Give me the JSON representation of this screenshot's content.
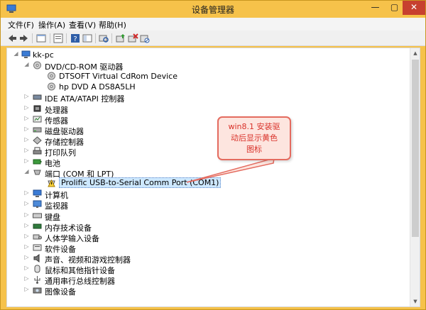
{
  "window": {
    "title": "设备管理器",
    "minimize": "—",
    "maximize": "▢",
    "close": "✕"
  },
  "menu": [
    {
      "label": "文件(F)"
    },
    {
      "label": "操作(A)"
    },
    {
      "label": "查看(V)"
    },
    {
      "label": "帮助(H)"
    }
  ],
  "toolbar": [
    {
      "name": "back-icon"
    },
    {
      "name": "forward-icon"
    },
    {
      "name": "properties-view-icon"
    },
    {
      "name": "show-hide-icon"
    },
    {
      "name": "help-icon"
    },
    {
      "name": "console-icon"
    },
    {
      "name": "scan-hardware-icon"
    },
    {
      "name": "update-driver-icon"
    },
    {
      "name": "uninstall-icon"
    },
    {
      "name": "disable-icon"
    }
  ],
  "tree": {
    "root": "kk-pc",
    "nodes": [
      {
        "label": "DVD/CD-ROM 驱动器",
        "expanded": true,
        "icon": "dvd-icon"
      },
      {
        "label": "DTSOFT Virtual CdRom Device",
        "child": true,
        "icon": "dvd-icon"
      },
      {
        "label": "hp DVD A  DS8A5LH",
        "child": true,
        "icon": "dvd-icon"
      },
      {
        "label": "IDE ATA/ATAPI 控制器",
        "icon": "ide-controller-icon"
      },
      {
        "label": "处理器",
        "icon": "processor-icon"
      },
      {
        "label": "传感器",
        "icon": "sensor-icon"
      },
      {
        "label": "磁盘驱动器",
        "icon": "disk-drive-icon"
      },
      {
        "label": "存储控制器",
        "icon": "storage-controller-icon"
      },
      {
        "label": "打印队列",
        "icon": "printer-icon"
      },
      {
        "label": "电池",
        "icon": "battery-icon"
      },
      {
        "label": "端口 (COM 和 LPT)",
        "expanded": true,
        "icon": "port-icon"
      },
      {
        "label": "Prolific USB-to-Serial Comm Port (COM1)",
        "child": true,
        "icon": "warning-port-icon",
        "selected": true
      },
      {
        "label": "计算机",
        "icon": "computer-icon"
      },
      {
        "label": "监视器",
        "icon": "monitor-icon"
      },
      {
        "label": "键盘",
        "icon": "keyboard-icon"
      },
      {
        "label": "内存技术设备",
        "icon": "memory-icon"
      },
      {
        "label": "人体学输入设备",
        "icon": "hid-icon"
      },
      {
        "label": "软件设备",
        "icon": "software-device-icon"
      },
      {
        "label": "声音、视频和游戏控制器",
        "icon": "sound-icon"
      },
      {
        "label": "鼠标和其他指针设备",
        "icon": "mouse-icon"
      },
      {
        "label": "通用串行总线控制器",
        "icon": "usb-icon"
      },
      {
        "label": "图像设备",
        "icon": "imaging-icon"
      }
    ]
  },
  "callout": {
    "line1": "win8.1 安装驱",
    "line2": "动后显示黄色",
    "line3": "图标"
  },
  "colors": {
    "title_bar": "#f6c24a",
    "callout_border": "#e46b5f",
    "callout_text": "#d9322a",
    "selection": "#cde8ff"
  }
}
